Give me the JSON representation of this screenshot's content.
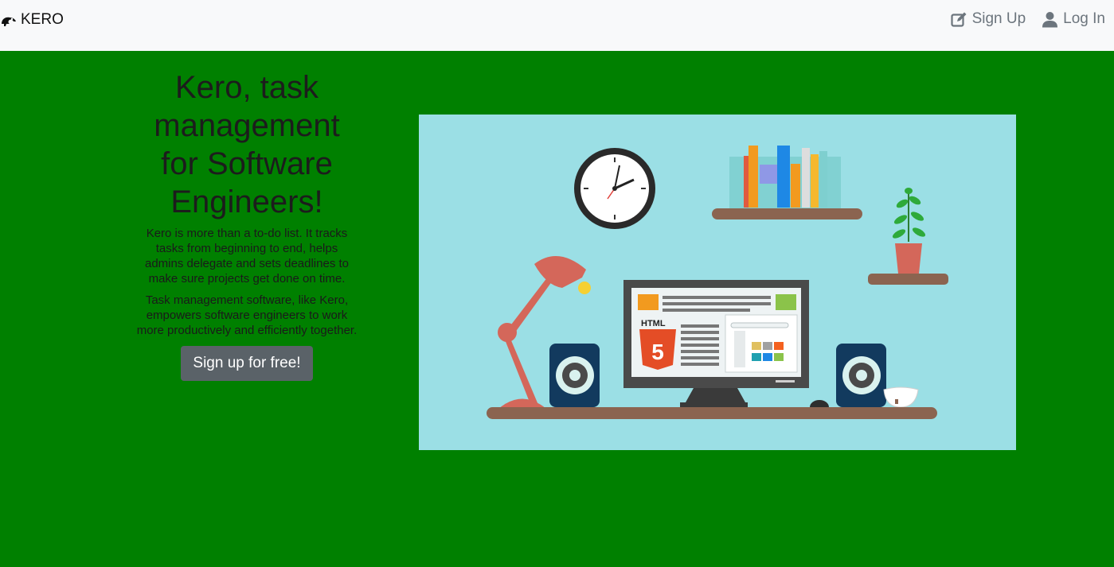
{
  "navbar": {
    "brand_label": "KERO",
    "brand_icon": "chameleon-icon",
    "links": [
      {
        "label": "Sign Up",
        "icon": "edit-icon"
      },
      {
        "label": "Log In",
        "icon": "user-icon"
      }
    ]
  },
  "hero": {
    "title": "Kero, task management for Software Engineers!",
    "paragraph_1": "Kero is more than a to-do list. It tracks tasks from beginning to end, helps admins delegate and sets deadlines to make sure projects get done on time.",
    "paragraph_2": "Task management software, like Kero, empowers software engineers to work more productively and efficiently together.",
    "cta_label": "Sign up for free!"
  },
  "illustration": {
    "badge_text": "HTML",
    "badge_number": "5",
    "colors": {
      "background": "#9bdfe5",
      "page": "#008000",
      "shelf": "#8b6450",
      "lamp": "#d4675a",
      "monitor": "#4a4a4a"
    }
  }
}
